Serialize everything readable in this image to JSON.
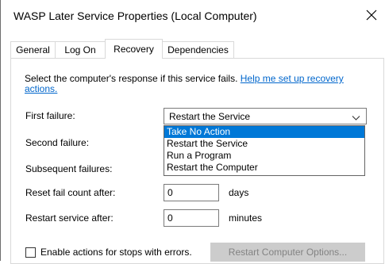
{
  "window": {
    "title": "WASP Later Service Properties (Local Computer)",
    "close_icon": "close-icon"
  },
  "tabs": [
    {
      "label": "General",
      "active": false
    },
    {
      "label": "Log On",
      "active": false
    },
    {
      "label": "Recovery",
      "active": true
    },
    {
      "label": "Dependencies",
      "active": false
    }
  ],
  "recovery": {
    "intro_text": "Select the computer's response if this service fails. ",
    "help_link": "Help me set up recovery actions.",
    "first_failure_label": "First failure:",
    "first_failure_value": "Restart the Service",
    "second_failure_label": "Second failure:",
    "subsequent_failures_label": "Subsequent failures:",
    "dropdown_options": [
      {
        "label": "Take No Action",
        "highlighted": true
      },
      {
        "label": "Restart the Service",
        "highlighted": false
      },
      {
        "label": "Run a Program",
        "highlighted": false
      },
      {
        "label": "Restart the Computer",
        "highlighted": false
      }
    ],
    "reset_count_label": "Reset fail count after:",
    "reset_count_value": "0",
    "reset_count_unit": "days",
    "restart_service_label": "Restart service after:",
    "restart_service_value": "0",
    "restart_service_unit": "minutes",
    "enable_actions_label": "Enable actions for stops with errors.",
    "enable_actions_checked": false,
    "restart_computer_options_button": "Restart Computer Options..."
  },
  "colors": {
    "highlight": "#0078d7",
    "link": "#0066cc",
    "disabled_button_bg": "#cccccc",
    "disabled_button_text": "#838383"
  }
}
